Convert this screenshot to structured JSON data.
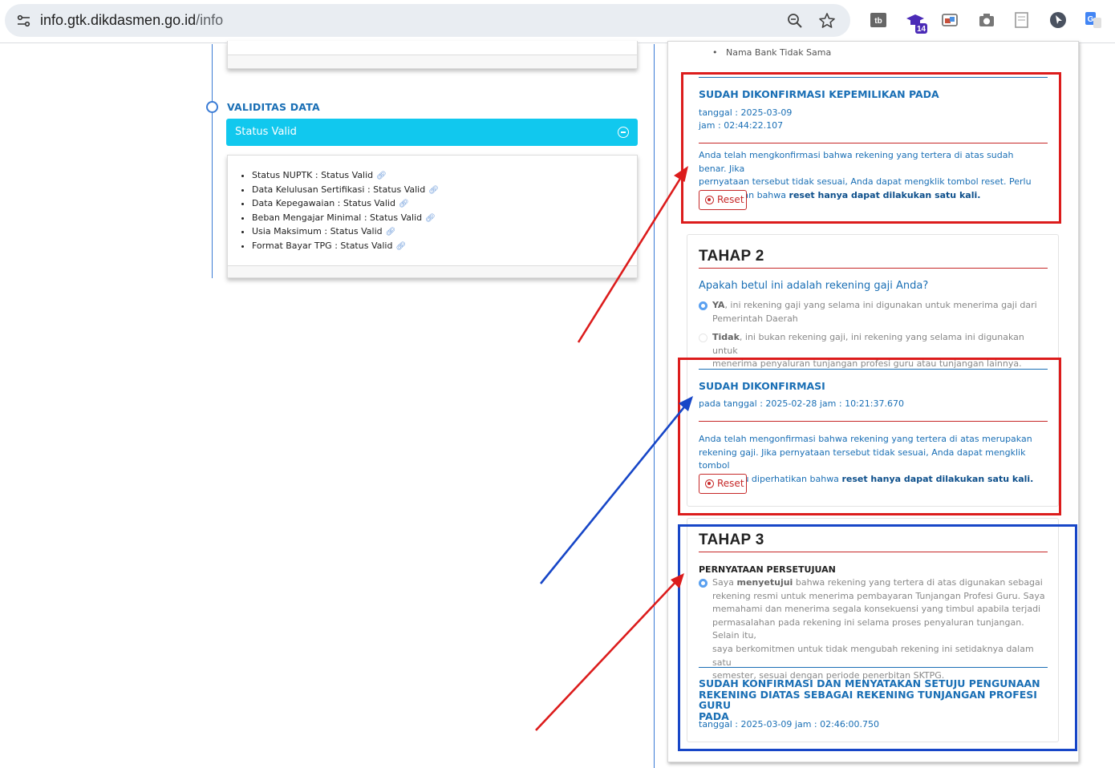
{
  "browser": {
    "url_host": "info.gtk.dikdasmen.go.id",
    "url_path": "/info",
    "ext_badge": "14"
  },
  "left": {
    "section_title": "VALIDITAS DATA",
    "status_header": "Status Valid",
    "items": [
      "Status NUPTK : Status Valid",
      "Data Kelulusan Sertifikasi : Status Valid",
      "Data Kepegawaian : Status Valid",
      "Beban Mengajar Minimal : Status Valid",
      "Usia Maksimum : Status Valid",
      "Format Bayar TPG : Status Valid"
    ]
  },
  "right": {
    "prev_bullet": "Nama Bank Tidak Sama",
    "konf1": {
      "title": "SUDAH DIKONFIRMASI KEPEMILIKAN PADA",
      "tanggal": "tanggal : 2025-03-09",
      "jam": "jam : 02:44:22.107",
      "para_lines": [
        "Anda telah mengkonfirmasi bahwa rekening yang tertera di atas sudah benar. Jika",
        "pernyataan tersebut tidak sesuai, Anda dapat mengklik tombol reset. Perlu"
      ],
      "para_last_prefix": "diperhatikan bahwa ",
      "para_last_bold": "reset hanya dapat dilakukan satu kali.",
      "reset": "Reset"
    },
    "tahap2": {
      "title": "TAHAP 2",
      "question": "Apakah betul ini adalah rekening gaji Anda?",
      "opt_ya_bold": "YA",
      "opt_ya_rest": ", ini rekening gaji yang selama ini digunakan untuk menerima gaji dari",
      "opt_ya_line2": "Pemerintah Daerah",
      "opt_tidak_bold": "Tidak",
      "opt_tidak_rest": ", ini bukan rekening gaji, ini rekening yang selama ini digunakan untuk",
      "opt_tidak_line2": "menerima penyaluran tunjangan profesi guru atau tunjangan lainnya.",
      "konf_title": "SUDAH DIKONFIRMASI",
      "konf_date": "pada tanggal : 2025-02-28 jam : 10:21:37.670",
      "para_lines": [
        "Anda telah mengonfirmasi bahwa rekening yang tertera di atas merupakan",
        "rekening gaji. Jika pernyataan tersebut tidak sesuai, Anda dapat mengklik tombol"
      ],
      "para_last_prefix": "reset. Perlu diperhatikan bahwa ",
      "para_last_bold": "reset hanya dapat dilakukan satu kali.",
      "reset": "Reset"
    },
    "tahap3": {
      "title": "TAHAP 3",
      "subtitle": "PERNYATAAN PERSETUJUAN",
      "agree_prefix": "Saya ",
      "agree_bold": "menyetujui",
      "agree_rest": " bahwa rekening yang tertera di atas digunakan sebagai",
      "agree_lines": [
        "rekening resmi untuk menerima pembayaran Tunjangan Profesi Guru. Saya",
        "memahami dan menerima segala konsekuensi yang timbul apabila terjadi",
        "permasalahan pada rekening ini selama proses penyaluran tunjangan. Selain itu,",
        "saya berkomitmen untuk tidak mengubah rekening ini setidaknya dalam satu",
        "semester, sesuai dengan periode penerbitan SKTPG."
      ],
      "konf_title_lines": [
        "SUDAH KONFIRMASI DAN MENYATAKAN SETUJU PENGUNAAN",
        "REKENING DIATAS SEBAGAI REKENING TUNJANGAN PROFESI GURU",
        "PADA"
      ],
      "konf_date": "tanggal : 2025-03-09 jam : 02:46:00.750"
    }
  },
  "colors": {
    "accent": "#1a6fb5",
    "status_bar": "#11c8ee",
    "annot_red": "#dc1c1c",
    "annot_blue": "#1746c7"
  }
}
